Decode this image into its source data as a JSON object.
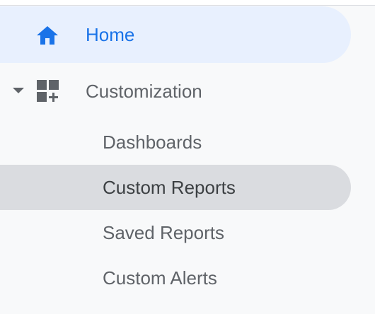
{
  "nav": {
    "home": {
      "label": "Home",
      "icon": "home-icon",
      "color": "#1a73e8",
      "background": "#e8f0fe"
    },
    "section": {
      "label": "Customization",
      "icon": "dashboard-add-icon",
      "expanded": true
    },
    "items": [
      {
        "label": "Dashboards",
        "active": false
      },
      {
        "label": "Custom Reports",
        "active": true
      },
      {
        "label": "Saved Reports",
        "active": false
      },
      {
        "label": "Custom Alerts",
        "active": false
      }
    ]
  }
}
